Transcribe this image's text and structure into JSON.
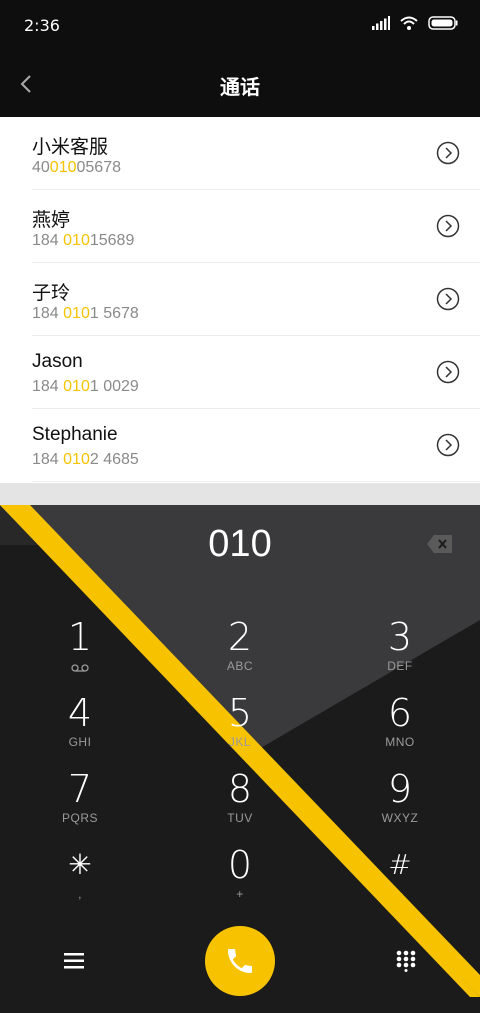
{
  "status_bar": {
    "time": "2:36"
  },
  "header": {
    "title": "通话"
  },
  "contacts": [
    {
      "name": "小米客服",
      "num_pre": "40",
      "num_hl": "010",
      "num_post": "05678"
    },
    {
      "name": "燕婷",
      "num_pre": "184 ",
      "num_hl": "010",
      "num_post": "15689"
    },
    {
      "name": "子玲",
      "num_pre": "184 ",
      "num_hl": "010",
      "num_post": "1 5678"
    },
    {
      "name": "Jason",
      "num_pre": "184 ",
      "num_hl": "010",
      "num_post": "1 0029"
    },
    {
      "name": "Stephanie",
      "num_pre": "184 ",
      "num_hl": "010",
      "num_post": "2 4685"
    }
  ],
  "dialpad": {
    "display": "010",
    "keys": [
      {
        "digit": "1",
        "letters": ""
      },
      {
        "digit": "2",
        "letters": "ABC"
      },
      {
        "digit": "3",
        "letters": "DEF"
      },
      {
        "digit": "4",
        "letters": "GHI"
      },
      {
        "digit": "5",
        "letters": "JKL"
      },
      {
        "digit": "6",
        "letters": "MNO"
      },
      {
        "digit": "7",
        "letters": "PQRS"
      },
      {
        "digit": "8",
        "letters": "TUV"
      },
      {
        "digit": "9",
        "letters": "WXYZ"
      },
      {
        "digit": "✳",
        "letters": ","
      },
      {
        "digit": "0",
        "letters": "+"
      },
      {
        "digit": "#",
        "letters": ""
      }
    ]
  },
  "colors": {
    "accent": "#f7c300",
    "background": "#1b1b1b",
    "list_bg": "#ffffff"
  }
}
